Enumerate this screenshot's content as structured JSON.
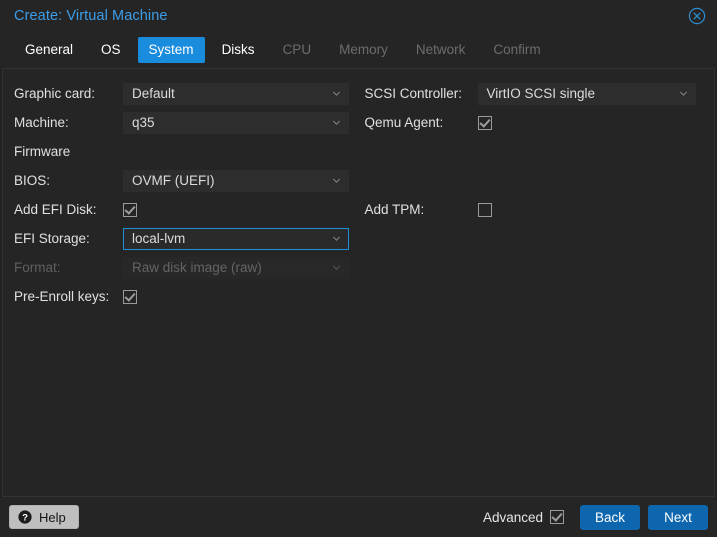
{
  "window": {
    "title": "Create: Virtual Machine",
    "close_icon": "close-circle-icon"
  },
  "tabs": [
    {
      "label": "General",
      "state": "enabled"
    },
    {
      "label": "OS",
      "state": "enabled"
    },
    {
      "label": "System",
      "state": "active"
    },
    {
      "label": "Disks",
      "state": "enabled"
    },
    {
      "label": "CPU",
      "state": "disabled"
    },
    {
      "label": "Memory",
      "state": "disabled"
    },
    {
      "label": "Network",
      "state": "disabled"
    },
    {
      "label": "Confirm",
      "state": "disabled"
    }
  ],
  "form": {
    "left": {
      "graphic_card": {
        "label": "Graphic card:",
        "value": "Default"
      },
      "machine": {
        "label": "Machine:",
        "value": "q35"
      },
      "firmware": {
        "label": "Firmware"
      },
      "bios": {
        "label": "BIOS:",
        "value": "OVMF (UEFI)"
      },
      "add_efi_disk": {
        "label": "Add EFI Disk:",
        "checked": true
      },
      "efi_storage": {
        "label": "EFI Storage:",
        "value": "local-lvm",
        "focused": true
      },
      "format": {
        "label": "Format:",
        "value": "Raw disk image (raw)",
        "disabled": true
      },
      "pre_enroll_keys": {
        "label": "Pre-Enroll keys:",
        "checked": true
      }
    },
    "right": {
      "scsi_controller": {
        "label": "SCSI Controller:",
        "value": "VirtIO SCSI single"
      },
      "qemu_agent": {
        "label": "Qemu Agent:",
        "checked": true
      },
      "add_tpm": {
        "label": "Add TPM:",
        "checked": false
      }
    }
  },
  "footer": {
    "help_label": "Help",
    "help_icon": "question-circle-icon",
    "advanced_label": "Advanced",
    "advanced_checked": true,
    "back_label": "Back",
    "next_label": "Next"
  },
  "colors": {
    "accent_blue": "#1a8cdd",
    "title_blue": "#3c9de8",
    "button_blue": "#0e67ae",
    "focus_border": "#1f8fd8",
    "panel_bg": "#252525",
    "field_bg": "#2d2d2d"
  }
}
